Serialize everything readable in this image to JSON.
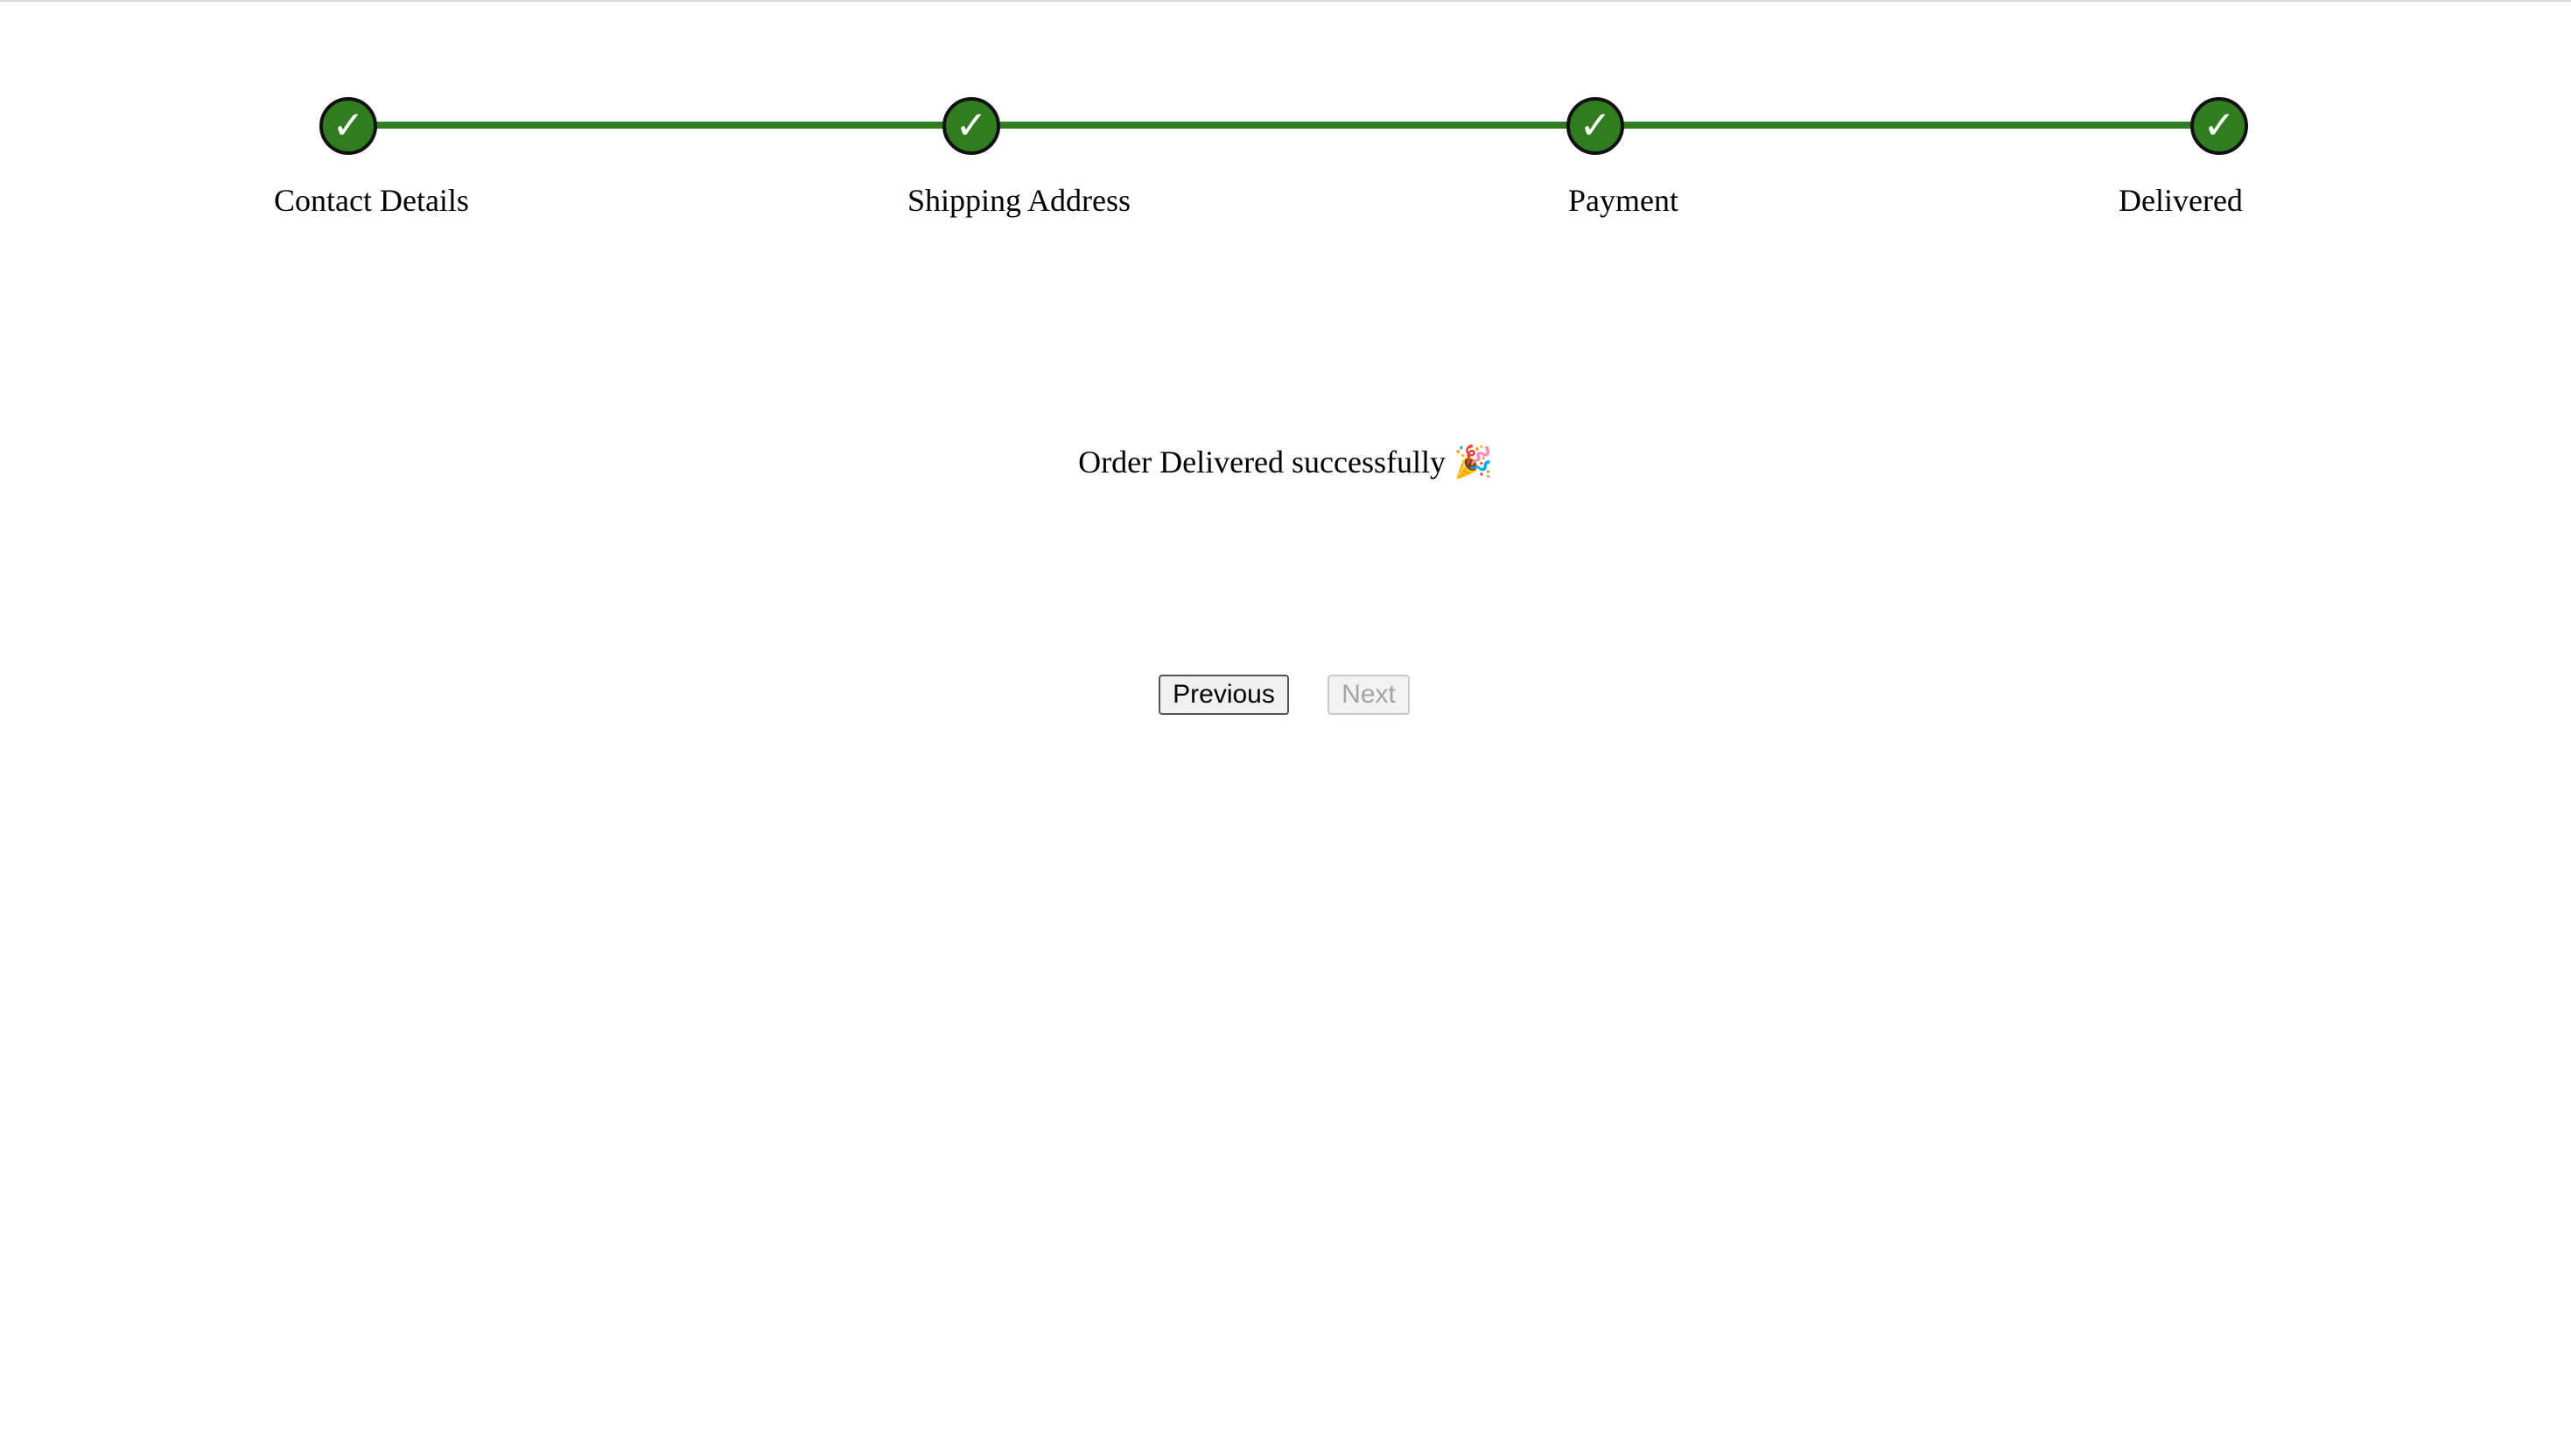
{
  "stepper": {
    "progress_color": "#2f7d1f",
    "steps": [
      {
        "label": "Contact Details",
        "status": "completed",
        "icon": "checkmark-icon",
        "glyph": "✓"
      },
      {
        "label": "Shipping Address",
        "status": "completed",
        "icon": "checkmark-icon",
        "glyph": "✓"
      },
      {
        "label": "Payment",
        "status": "completed",
        "icon": "checkmark-icon",
        "glyph": "✓"
      },
      {
        "label": "Delivered",
        "status": "completed",
        "icon": "checkmark-icon",
        "glyph": "✓"
      }
    ]
  },
  "main": {
    "message": "Order Delivered successfully",
    "message_icon": "party-popper-icon",
    "message_emoji": "🎉"
  },
  "nav": {
    "previous_label": "Previous",
    "next_label": "Next",
    "next_disabled": true
  }
}
